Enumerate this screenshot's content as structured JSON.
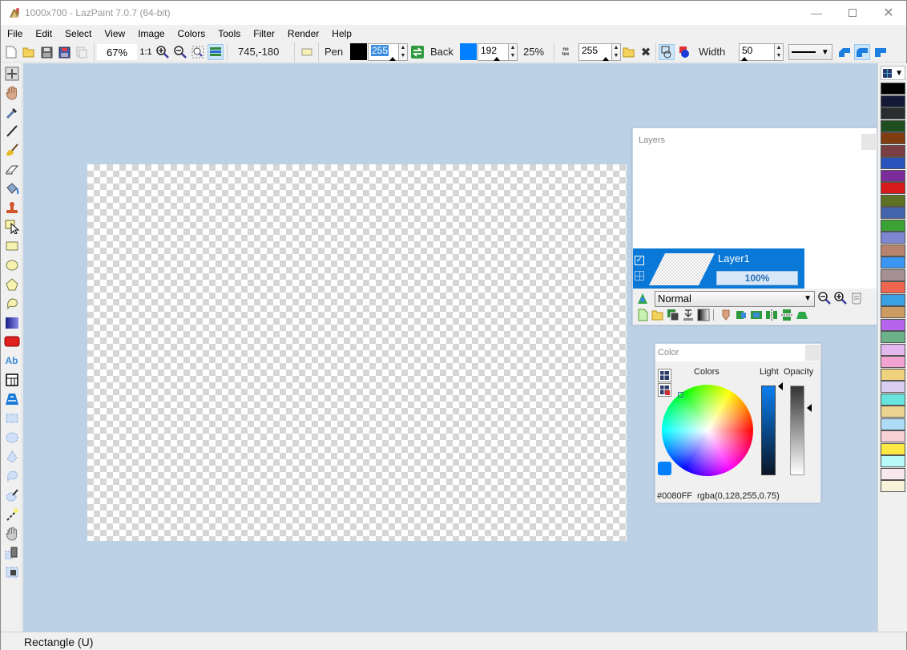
{
  "window": {
    "title": "1000x700 - LazPaint 7.0.7 (64-bit)",
    "minimize_icon": "minimize-icon",
    "maximize_icon": "maximize-icon",
    "close_icon": "close-icon"
  },
  "menu": [
    "File",
    "Edit",
    "Select",
    "View",
    "Image",
    "Colors",
    "Tools",
    "Filter",
    "Render",
    "Help"
  ],
  "toolbar": {
    "zoom_value": "67%",
    "zoom_actual_label": "1:1",
    "coordinates": "745,-180",
    "pen_label": "Pen",
    "pen_color": "#000000",
    "pen_alpha": "255",
    "back_label": "Back",
    "back_color": "#0080FF",
    "back_alpha": "192",
    "tolerance": "25%",
    "texture_alpha": "255",
    "width_label": "Width",
    "width_value": "50"
  },
  "tools": [
    "move-selection",
    "hand",
    "color-picker",
    "pen",
    "brush",
    "eraser",
    "flood-fill",
    "clone-stamp",
    "edit-shape",
    "rectangle",
    "ellipse",
    "polygon",
    "spline",
    "gradient",
    "phong-shape",
    "text",
    "deformation-grid",
    "perspective",
    "select-rect",
    "select-ellipse",
    "select-poly",
    "select-spline",
    "magic-wand",
    "select-pen",
    "move-selection-content",
    "rotate-selection",
    "crop-selection"
  ],
  "palette": {
    "colors": [
      "#000000",
      "#141a36",
      "#292d2f",
      "#1f4e20",
      "#7f3d10",
      "#7a3f43",
      "#2a52bd",
      "#7c2b9b",
      "#d8191c",
      "#5d7125",
      "#4463ad",
      "#3ba336",
      "#7d86d1",
      "#b8836e",
      "#3b95f3",
      "#a59193",
      "#ef6650",
      "#3aa0e4",
      "#cc9c62",
      "#b564ed",
      "#6cb189",
      "#e2b8ef",
      "#f3a3d0",
      "#efd27d",
      "#d9cdf2",
      "#66e4dd",
      "#ebd491",
      "#aedcf6",
      "#f7d0d4",
      "#fce944",
      "#b8fafa",
      "#f6e8ec",
      "#f7f2d9"
    ]
  },
  "layers_panel": {
    "title": "Layers",
    "layer_name": "Layer1",
    "layer_opacity": "100%",
    "layer_visible": true,
    "blend_mode": "Normal"
  },
  "color_panel": {
    "title": "Color",
    "colors_label": "Colors",
    "light_label": "Light",
    "opacity_label": "Opacity",
    "hex": "#0080FF",
    "rgba": "rgba(0,128,255,0.75)",
    "current_color": "#0080FF"
  },
  "status": {
    "text": "Rectangle (U)"
  }
}
